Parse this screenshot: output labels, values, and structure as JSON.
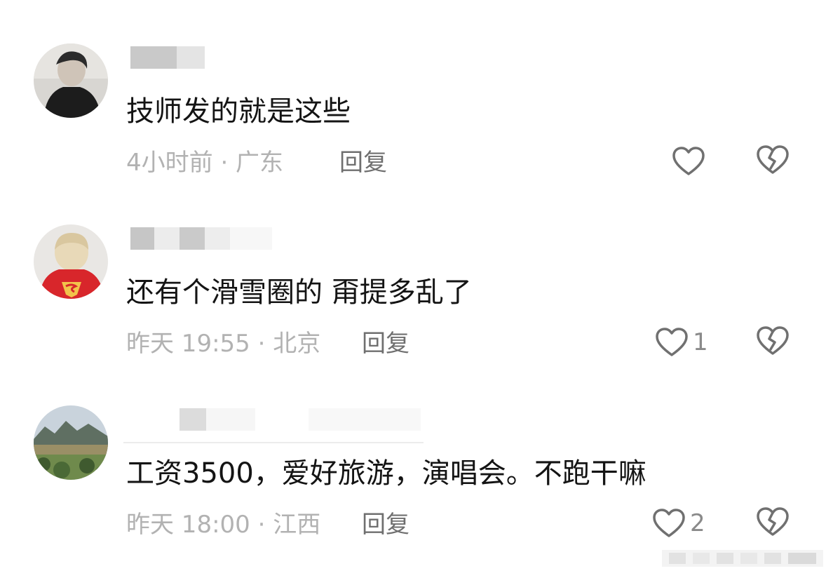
{
  "comments": [
    {
      "text": "技师发的就是这些",
      "meta": "4小时前 · 广东",
      "reply_label": "回复",
      "like_count": "",
      "avatar_icon": "avatar-man-dark-shirt"
    },
    {
      "text": "还有个滑雪圈的 甭提多乱了",
      "meta": "昨天 19:55 · 北京",
      "reply_label": "回复",
      "like_count": "1",
      "avatar_icon": "avatar-child-superman-cape"
    },
    {
      "text": "工资3500，爱好旅游，演唱会。不跑干嘛",
      "meta": "昨天 18:00 · 江西",
      "reply_label": "回复",
      "like_count": "2",
      "avatar_icon": "avatar-mountain-landscape"
    }
  ],
  "icons": {
    "like": "heart-outline-icon",
    "dislike": "broken-heart-icon"
  },
  "colors": {
    "text_primary": "#141414",
    "text_meta": "#b2b2b2",
    "text_reply": "#6f6f6f",
    "icon_gray": "#707070"
  }
}
